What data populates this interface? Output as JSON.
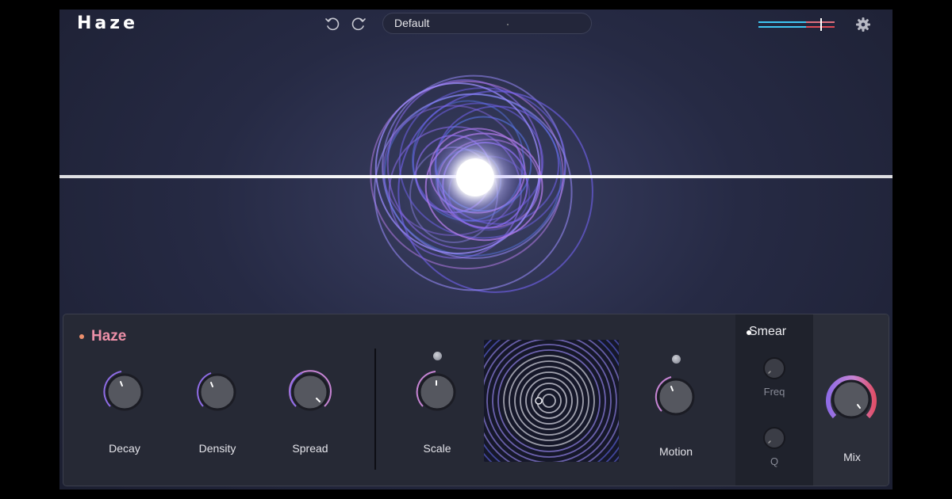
{
  "app": {
    "title": "Haze"
  },
  "toolbar": {
    "preset": "Default"
  },
  "colors": {
    "accent": "#ec8fa7",
    "ring": "#8f6ce6",
    "glow": "#ffffff"
  },
  "icons": {
    "undo": "undo-icon",
    "redo": "redo-icon",
    "settings": "gear-icon",
    "meter": "io-meter-icon"
  },
  "haze_section": {
    "title": "Haze",
    "knobs": [
      {
        "label": "Decay"
      },
      {
        "label": "Density"
      },
      {
        "label": "Spread"
      }
    ]
  },
  "motion_section": {
    "knobs": [
      {
        "label": "Scale"
      },
      {
        "label": "Motion"
      }
    ]
  },
  "smear_section": {
    "title": "Smear",
    "knobs": [
      {
        "label": "Freq"
      },
      {
        "label": "Q"
      }
    ]
  },
  "mix_section": {
    "label": "Mix"
  }
}
